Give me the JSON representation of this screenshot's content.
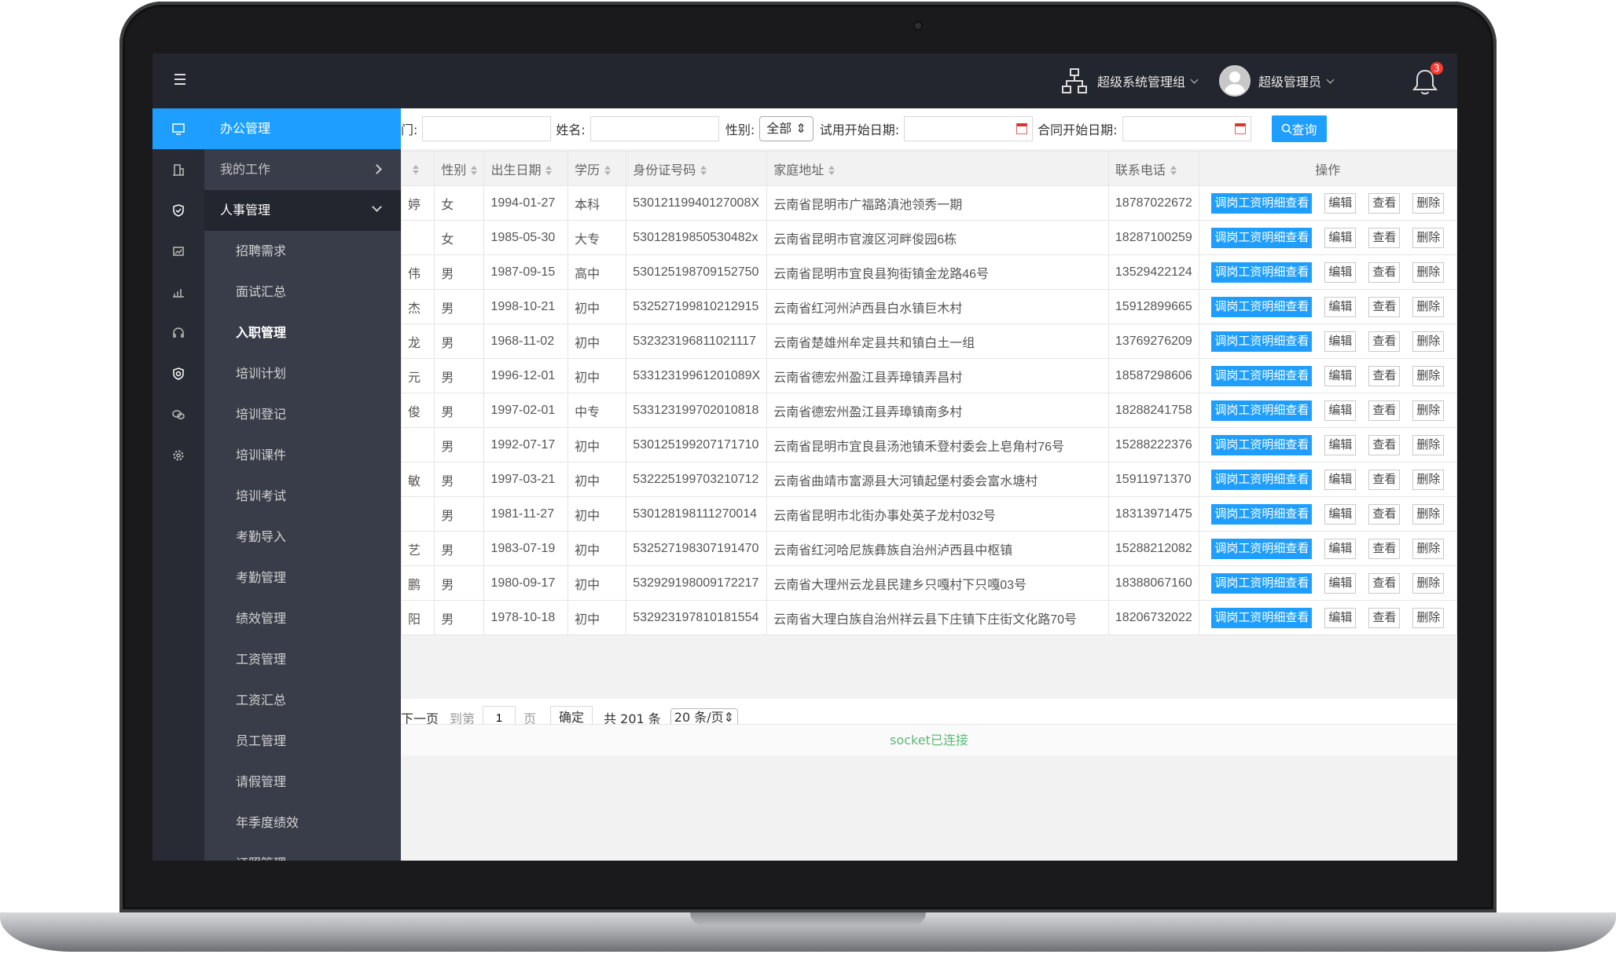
{
  "topbar": {
    "group_label": "超级系统管理组",
    "user_label": "超级管理员",
    "notification_count": "3"
  },
  "menu": {
    "header": "办公管理",
    "my_work": "我的工作",
    "hr": "人事管理",
    "sub_items": [
      "招聘需求",
      "面试汇总",
      "入职管理",
      "培训计划",
      "培训登记",
      "培训课件",
      "培训考试",
      "考勤导入",
      "考勤管理",
      "绩效管理",
      "工资管理",
      "工资汇总",
      "员工管理",
      "请假管理",
      "年季度绩效",
      "证照管理"
    ]
  },
  "filters": {
    "dept_label": "门:",
    "name_label": "姓名:",
    "gender_label": "性别:",
    "gender_value": "全部",
    "trial_date_label": "试用开始日期:",
    "contract_date_label": "合同开始日期:",
    "query_button": "查询"
  },
  "table": {
    "headers": [
      "",
      "性别",
      "出生日期",
      "学历",
      "身份证号码",
      "家庭地址",
      "联系电话",
      "操作"
    ],
    "ops": {
      "salary_detail": "调岗工资明细查看",
      "edit": "编辑",
      "view": "查看",
      "delete": "删除"
    },
    "rows": [
      [
        "婷",
        "女",
        "1994-01-27",
        "本科",
        "53012119940127008X",
        "云南省昆明市广福路滇池领秀一期",
        "18787022672"
      ],
      [
        "",
        "女",
        "1985-05-30",
        "大专",
        "530128198505304​82x",
        "云南省昆明市官渡区河畔俊园6栋",
        "18287100259"
      ],
      [
        "伟",
        "男",
        "1987-09-15",
        "高中",
        "530125198709152750",
        "云南省昆明市宜良县狗街镇金龙路46号",
        "13529422124"
      ],
      [
        "杰",
        "男",
        "1998-10-21",
        "初中",
        "532527199810212915",
        "云南省红河州泸西县白水镇巨木村",
        "15912899665"
      ],
      [
        "龙",
        "男",
        "1968-11-02",
        "初中",
        "532323196811021117",
        "云南省楚雄州牟定县共和镇白土一组",
        "13769276209"
      ],
      [
        "元",
        "男",
        "1996-12-01",
        "初中",
        "53312319961201089X",
        "云南省德宏州盈江县弄璋镇弄昌村",
        "18587298606"
      ],
      [
        "俊",
        "男",
        "1997-02-01",
        "中专",
        "533123199702010818",
        "云南省德宏州盈江县弄璋镇南多村",
        "18288241758"
      ],
      [
        "",
        "男",
        "1992-07-17",
        "初中",
        "530125199207171710",
        "云南省昆明市宜良县汤池镇禾登村委会上皂角村76号",
        "15288222376"
      ],
      [
        "敏",
        "男",
        "1997-03-21",
        "初中",
        "532225199703210712",
        "云南省曲靖市富源县大河镇起堡村委会富水塘村",
        "15911971370"
      ],
      [
        "",
        "男",
        "1981-11-27",
        "初中",
        "530128198111270014",
        "云南省昆明市北街办事处英子龙村032号",
        "18313971475"
      ],
      [
        "艺",
        "男",
        "1983-07-19",
        "初中",
        "532527198307191470",
        "云南省红河哈尼族彝族自治州泸西县中枢镇",
        "15288212082"
      ],
      [
        "鹏",
        "男",
        "1980-09-17",
        "初中",
        "532929198009172217",
        "云南省大理州云龙县民建乡只嘎村下只嘎03号",
        "18388067160"
      ],
      [
        "阳",
        "男",
        "1978-10-18",
        "初中",
        "532923197810181554",
        "云南省大理白族自治州祥云县下庄镇下庄街文化路70号",
        "18206732022"
      ]
    ]
  },
  "pager": {
    "next": "下一页",
    "goto": "到第",
    "page_value": "1",
    "page_unit": "页",
    "confirm": "确定",
    "total": "共 201 条",
    "page_size": "20 条/页"
  },
  "status": "socket已连接"
}
